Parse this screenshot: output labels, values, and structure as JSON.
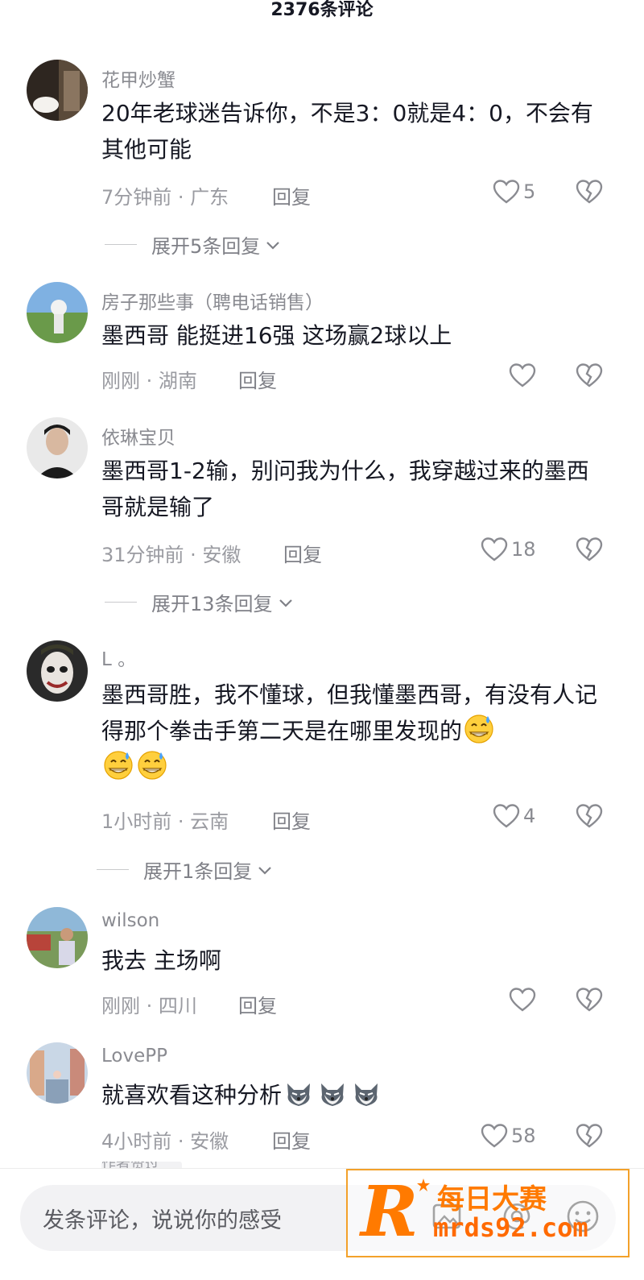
{
  "header": {
    "title": "2376条评论"
  },
  "comments": [
    {
      "username": "花甲炒蟹",
      "text": "20年老球迷告诉你，不是3：0就是4：0，不会有其他可能",
      "time": "7分钟前 · 广东",
      "reply": "回复",
      "likes": "5",
      "expand": "展开5条回复"
    },
    {
      "username": "房子那些事（聘电话销售）",
      "text": "墨西哥 能挺进16强  这场赢2球以上",
      "time": "刚刚 · 湖南",
      "reply": "回复",
      "likes": ""
    },
    {
      "username": "依琳宝贝",
      "text": "墨西哥1-2输，别问我为什么，我穿越过来的墨西哥就是输了",
      "time": "31分钟前 · 安徽",
      "reply": "回复",
      "likes": "18",
      "expand": "展开13条回复"
    },
    {
      "username": "L 。",
      "text": "墨西哥胜，我不懂球，但我懂墨西哥，有没有人记得那个拳击手第二天是在哪里发现的",
      "time": "1小时前 · 云南",
      "reply": "回复",
      "likes": "4",
      "expand": "展开1条回复"
    },
    {
      "username": "wilson",
      "text": "我去 主场啊",
      "time": "刚刚 · 四川",
      "reply": "回复",
      "likes": ""
    },
    {
      "username": "LovePP",
      "text": "就喜欢看这种分析",
      "time": "4小时前 · 安徽",
      "reply": "回复",
      "likes": "58"
    }
  ],
  "partial_tag": "作者赞过",
  "bottom_bar": {
    "placeholder": "发条评论，说说你的感受"
  },
  "watermark": {
    "title": "每日大赛",
    "url": "mrds92.com",
    "logo_letter": "R"
  },
  "icons": {
    "like": "heart-outline-icon",
    "dislike": "broken-heart-icon",
    "chevron": "chevron-down-icon",
    "emoji1": "grinning-sweat-emoji",
    "emoji2": "wolf-dog-emoji"
  }
}
